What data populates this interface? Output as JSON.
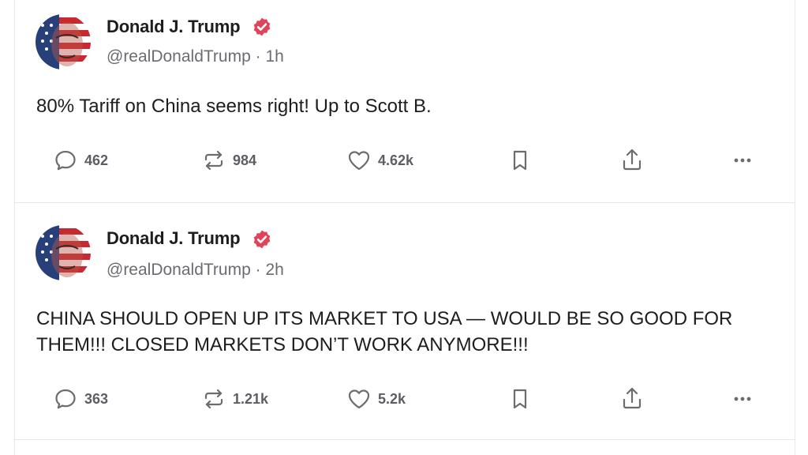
{
  "posts": [
    {
      "author": "Donald J. Trump",
      "handle": "@realDonaldTrump · 1h",
      "text": "80% Tariff on China seems right! Up to Scott B.",
      "replies": "462",
      "reposts": "984",
      "likes": "4.62k"
    },
    {
      "author": "Donald J. Trump",
      "handle": "@realDonaldTrump · 2h",
      "text": "CHINA SHOULD OPEN UP ITS MARKET TO USA — WOULD BE SO GOOD FOR THEM!!! CLOSED MARKETS DON’T WORK ANYMORE!!!",
      "replies": "363",
      "reposts": "1.21k",
      "likes": "5.2k"
    }
  ],
  "icons": {
    "verified": "verified-badge-icon",
    "reply": "reply-icon",
    "repost": "repost-icon",
    "like": "heart-icon",
    "bookmark": "bookmark-icon",
    "share": "share-icon",
    "more": "more-icon"
  },
  "colors": {
    "verified": "#e0435a",
    "icon": "#6b6b70",
    "border": "#e8e8ea"
  }
}
